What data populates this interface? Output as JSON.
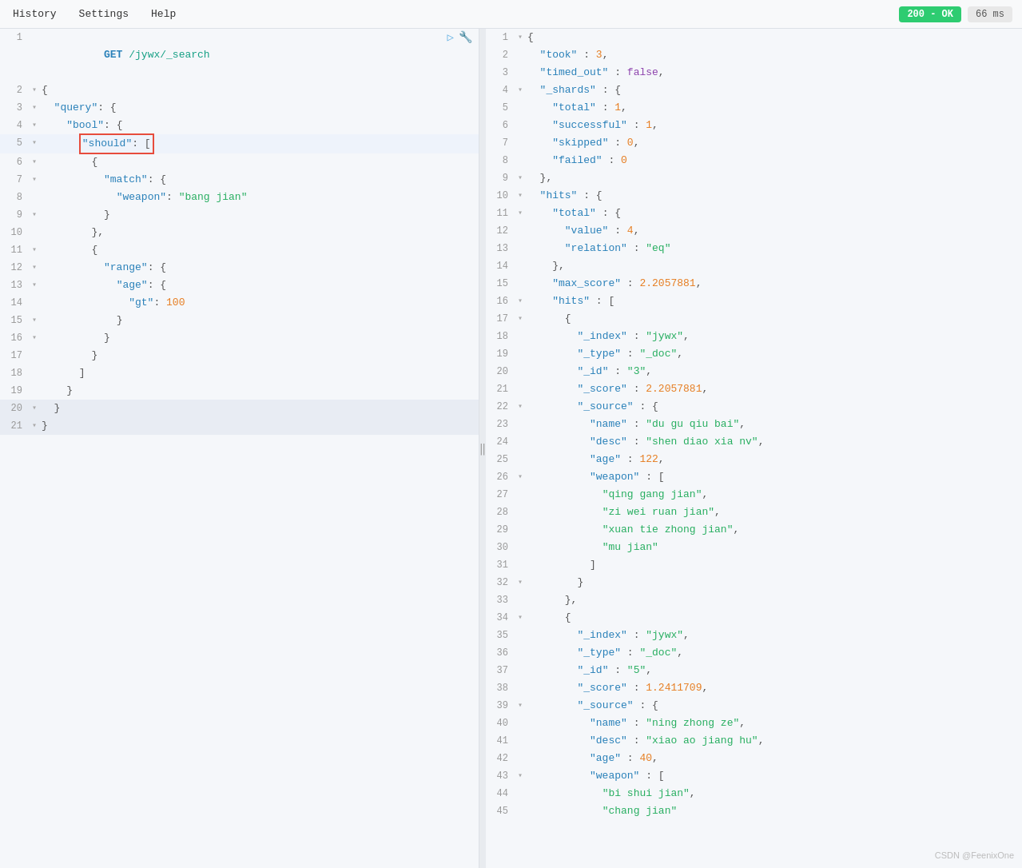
{
  "menu": {
    "items": [
      "History",
      "Settings",
      "Help"
    ]
  },
  "status": {
    "ok_label": "200 - OK",
    "time_label": "66 ms"
  },
  "left_panel": {
    "lines": [
      {
        "num": 1,
        "fold": "",
        "content": "GET /jywx/_search",
        "type": "request"
      },
      {
        "num": 2,
        "fold": "▾",
        "content": "{",
        "type": "normal"
      },
      {
        "num": 3,
        "fold": "▾",
        "content": "  \"query\": {",
        "type": "normal"
      },
      {
        "num": 4,
        "fold": "▾",
        "content": "    \"bool\": {",
        "type": "normal"
      },
      {
        "num": 5,
        "fold": "▾",
        "content": "      \"should\": [",
        "type": "highlighted"
      },
      {
        "num": 6,
        "fold": "▾",
        "content": "        {",
        "type": "normal"
      },
      {
        "num": 7,
        "fold": "▾",
        "content": "          \"match\": {",
        "type": "normal"
      },
      {
        "num": 8,
        "fold": "",
        "content": "            \"weapon\": \"bang jian\"",
        "type": "normal"
      },
      {
        "num": 9,
        "fold": "",
        "content": "          }",
        "type": "normal"
      },
      {
        "num": 10,
        "fold": "",
        "content": "        },",
        "type": "normal"
      },
      {
        "num": 11,
        "fold": "▾",
        "content": "        {",
        "type": "normal"
      },
      {
        "num": 12,
        "fold": "▾",
        "content": "          \"range\": {",
        "type": "normal"
      },
      {
        "num": 13,
        "fold": "▾",
        "content": "            \"age\": {",
        "type": "normal"
      },
      {
        "num": 14,
        "fold": "",
        "content": "              \"gt\": 100",
        "type": "normal"
      },
      {
        "num": 15,
        "fold": "",
        "content": "            }",
        "type": "normal"
      },
      {
        "num": 16,
        "fold": "",
        "content": "          }",
        "type": "normal"
      },
      {
        "num": 17,
        "fold": "",
        "content": "        }",
        "type": "normal"
      },
      {
        "num": 18,
        "fold": "",
        "content": "      ]",
        "type": "normal"
      },
      {
        "num": 19,
        "fold": "",
        "content": "    }",
        "type": "normal"
      },
      {
        "num": 20,
        "fold": "",
        "content": "  }",
        "type": "normal"
      },
      {
        "num": 21,
        "fold": "▾",
        "content": "}",
        "type": "normal"
      }
    ]
  },
  "right_panel": {
    "lines": [
      {
        "num": 1,
        "fold": "▾",
        "content": "{"
      },
      {
        "num": 2,
        "fold": "",
        "content": "  \"took\" : 3,"
      },
      {
        "num": 3,
        "fold": "",
        "content": "  \"timed_out\" : false,"
      },
      {
        "num": 4,
        "fold": "▾",
        "content": "  \"_shards\" : {"
      },
      {
        "num": 5,
        "fold": "",
        "content": "    \"total\" : 1,"
      },
      {
        "num": 6,
        "fold": "",
        "content": "    \"successful\" : 1,"
      },
      {
        "num": 7,
        "fold": "",
        "content": "    \"skipped\" : 0,"
      },
      {
        "num": 8,
        "fold": "",
        "content": "    \"failed\" : 0"
      },
      {
        "num": 9,
        "fold": "▾",
        "content": "  },"
      },
      {
        "num": 10,
        "fold": "▾",
        "content": "  \"hits\" : {"
      },
      {
        "num": 11,
        "fold": "▾",
        "content": "    \"total\" : {"
      },
      {
        "num": 12,
        "fold": "",
        "content": "      \"value\" : 4,"
      },
      {
        "num": 13,
        "fold": "",
        "content": "      \"relation\" : \"eq\""
      },
      {
        "num": 14,
        "fold": "",
        "content": "    },"
      },
      {
        "num": 15,
        "fold": "",
        "content": "    \"max_score\" : 2.2057881,"
      },
      {
        "num": 16,
        "fold": "▾",
        "content": "    \"hits\" : ["
      },
      {
        "num": 17,
        "fold": "▾",
        "content": "      {"
      },
      {
        "num": 18,
        "fold": "",
        "content": "        \"_index\" : \"jywx\","
      },
      {
        "num": 19,
        "fold": "",
        "content": "        \"_type\" : \"_doc\","
      },
      {
        "num": 20,
        "fold": "",
        "content": "        \"_id\" : \"3\","
      },
      {
        "num": 21,
        "fold": "",
        "content": "        \"_score\" : 2.2057881,"
      },
      {
        "num": 22,
        "fold": "▾",
        "content": "        \"_source\" : {"
      },
      {
        "num": 23,
        "fold": "",
        "content": "          \"name\" : \"du gu qiu bai\","
      },
      {
        "num": 24,
        "fold": "",
        "content": "          \"desc\" : \"shen diao xia nv\","
      },
      {
        "num": 25,
        "fold": "",
        "content": "          \"age\" : 122,"
      },
      {
        "num": 26,
        "fold": "▾",
        "content": "          \"weapon\" : ["
      },
      {
        "num": 27,
        "fold": "",
        "content": "            \"qing gang jian\","
      },
      {
        "num": 28,
        "fold": "",
        "content": "            \"zi wei ruan jian\","
      },
      {
        "num": 29,
        "fold": "",
        "content": "            \"xuan tie zhong jian\","
      },
      {
        "num": 30,
        "fold": "",
        "content": "            \"mu jian\""
      },
      {
        "num": 31,
        "fold": "",
        "content": "          ]"
      },
      {
        "num": 32,
        "fold": "▾",
        "content": "        }"
      },
      {
        "num": 33,
        "fold": "",
        "content": "      },"
      },
      {
        "num": 34,
        "fold": "▾",
        "content": "      {"
      },
      {
        "num": 35,
        "fold": "",
        "content": "        \"_index\" : \"jywx\","
      },
      {
        "num": 36,
        "fold": "",
        "content": "        \"_type\" : \"_doc\","
      },
      {
        "num": 37,
        "fold": "",
        "content": "        \"_id\" : \"5\","
      },
      {
        "num": 38,
        "fold": "",
        "content": "        \"_score\" : 1.2411709,"
      },
      {
        "num": 39,
        "fold": "▾",
        "content": "        \"_source\" : {"
      },
      {
        "num": 40,
        "fold": "",
        "content": "          \"name\" : \"ning zhong ze\","
      },
      {
        "num": 41,
        "fold": "",
        "content": "          \"desc\" : \"xiao ao jiang hu\","
      },
      {
        "num": 42,
        "fold": "",
        "content": "          \"age\" : 40,"
      },
      {
        "num": 43,
        "fold": "▾",
        "content": "          \"weapon\" : ["
      },
      {
        "num": 44,
        "fold": "",
        "content": "            \"bi shui jian\","
      },
      {
        "num": 45,
        "fold": "",
        "content": "            \"chang jian\""
      }
    ]
  },
  "watermark": "CSDN @FeenixOne",
  "icons": {
    "run": "▷",
    "settings": "🔧",
    "divider": "‖"
  }
}
